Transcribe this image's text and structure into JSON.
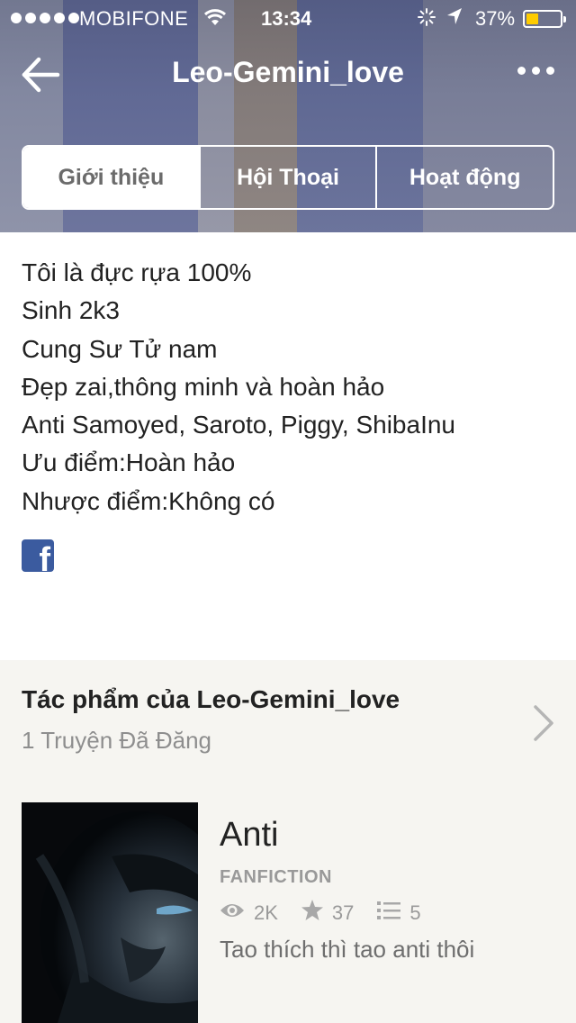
{
  "status_bar": {
    "carrier": "MOBIFONE",
    "time": "13:34",
    "battery_percent": "37%",
    "battery_level": 0.37,
    "battery_color": "#ffcc00"
  },
  "navbar": {
    "title": "Leo-Gemini_love"
  },
  "tabs": [
    {
      "label": "Giới thiệu",
      "active": true
    },
    {
      "label": "Hội Thoại",
      "active": false
    },
    {
      "label": "Hoạt động",
      "active": false
    }
  ],
  "bio": {
    "lines": [
      "Tôi là đực rựa 100%",
      "Sinh 2k3",
      "Cung Sư Tử nam",
      "Đẹp zai,thông minh và hoàn hảo",
      "Anti Samoyed, Saroto, Piggy, ShibaInu",
      "Ưu điểm:Hoàn hảo",
      "Nhược điểm:Không có"
    ],
    "social_icon": "facebook-icon",
    "facebook_color": "#3b5b9f"
  },
  "works": {
    "title": "Tác phẩm của Leo-Gemini_love",
    "subtitle": "1 Truyện Đã Đăng",
    "story": {
      "title": "Anti",
      "genre": "FANFICTION",
      "reads": "2K",
      "votes": "37",
      "parts": "5",
      "description": "Tao thích thì tao anti thôi"
    }
  }
}
